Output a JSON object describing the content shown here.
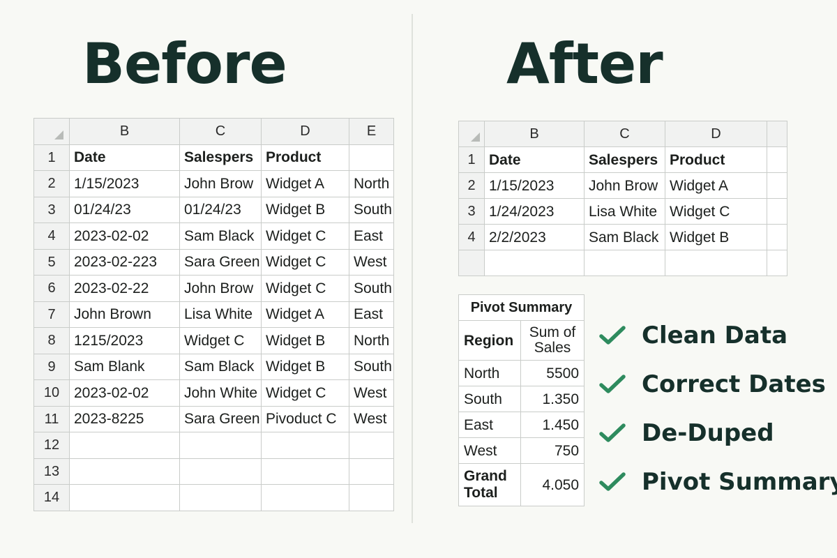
{
  "before": {
    "title": "Before",
    "columns": [
      "B",
      "C",
      "D",
      "E"
    ],
    "rows": [
      {
        "num": "1",
        "cells": [
          "Date",
          "Salespers",
          "Product",
          ""
        ]
      },
      {
        "num": "2",
        "cells": [
          "1/15/2023",
          "John Brow",
          "Widget A",
          "North"
        ]
      },
      {
        "num": "3",
        "cells": [
          "01/24/23",
          "01/24/23",
          "Widget B",
          "South"
        ]
      },
      {
        "num": "4",
        "cells": [
          "2023-02-02",
          "Sam Black",
          "Widget C",
          "East"
        ]
      },
      {
        "num": "5",
        "cells": [
          "2023-02-223",
          "Sara Green",
          "Widget C",
          "West"
        ]
      },
      {
        "num": "6",
        "cells": [
          "2023-02-22",
          "John Brow",
          "Widget C",
          "South"
        ]
      },
      {
        "num": "7",
        "cells": [
          "John Brown",
          "Lisa White",
          "Widget A",
          "East"
        ]
      },
      {
        "num": "8",
        "cells": [
          "1215/2023",
          "Widget C",
          "Widget B",
          "North"
        ]
      },
      {
        "num": "9",
        "cells": [
          "Sam Blank",
          "Sam Black",
          "Widget B",
          "South"
        ]
      },
      {
        "num": "10",
        "cells": [
          "2023-02-02",
          "John White",
          "Widget C",
          "West"
        ]
      },
      {
        "num": "11",
        "cells": [
          "2023-8225",
          "Sara Green",
          "Pivoduct C",
          "West"
        ]
      },
      {
        "num": "12",
        "cells": [
          "",
          "",
          "",
          ""
        ]
      },
      {
        "num": "13",
        "cells": [
          "",
          "",
          "",
          ""
        ]
      },
      {
        "num": "14",
        "cells": [
          "",
          "",
          "",
          ""
        ]
      }
    ]
  },
  "after": {
    "title": "After",
    "columns": [
      "B",
      "C",
      "D",
      ""
    ],
    "rows": [
      {
        "num": "1",
        "cells": [
          "Date",
          "Salespers",
          "Product",
          ""
        ]
      },
      {
        "num": "2",
        "cells": [
          "1/15/2023",
          "John Brow",
          "Widget A",
          ""
        ]
      },
      {
        "num": "3",
        "cells": [
          "1/24/2023",
          "Lisa White",
          "Widget C",
          ""
        ]
      },
      {
        "num": "4",
        "cells": [
          "2/2/2023",
          "Sam Black",
          "Widget B",
          ""
        ]
      },
      {
        "num": "",
        "cells": [
          "",
          "",
          "",
          ""
        ]
      }
    ]
  },
  "pivot": {
    "title": "Pivot Summary",
    "col_region": "Region",
    "col_sum_line1": "Sum of",
    "col_sum_line2": "Sales",
    "rows": [
      {
        "region": "North",
        "sales": "5500"
      },
      {
        "region": "South",
        "sales": "1.350"
      },
      {
        "region": "East",
        "sales": "1.450"
      },
      {
        "region": "West",
        "sales": "750"
      }
    ],
    "total_line1": "Grand",
    "total_line2": "Total",
    "total_value": "4.050"
  },
  "checklist": {
    "icon": "checkmark-icon",
    "check_color": "#2e8b5e",
    "items": [
      "Clean Data",
      "Correct Dates",
      "De-Duped",
      "Pivot Summary"
    ]
  },
  "colors": {
    "heading": "#16302b",
    "grid": "#c9ccc9",
    "header_fill": "#f1f2f1",
    "background": "#f8f9f5"
  }
}
